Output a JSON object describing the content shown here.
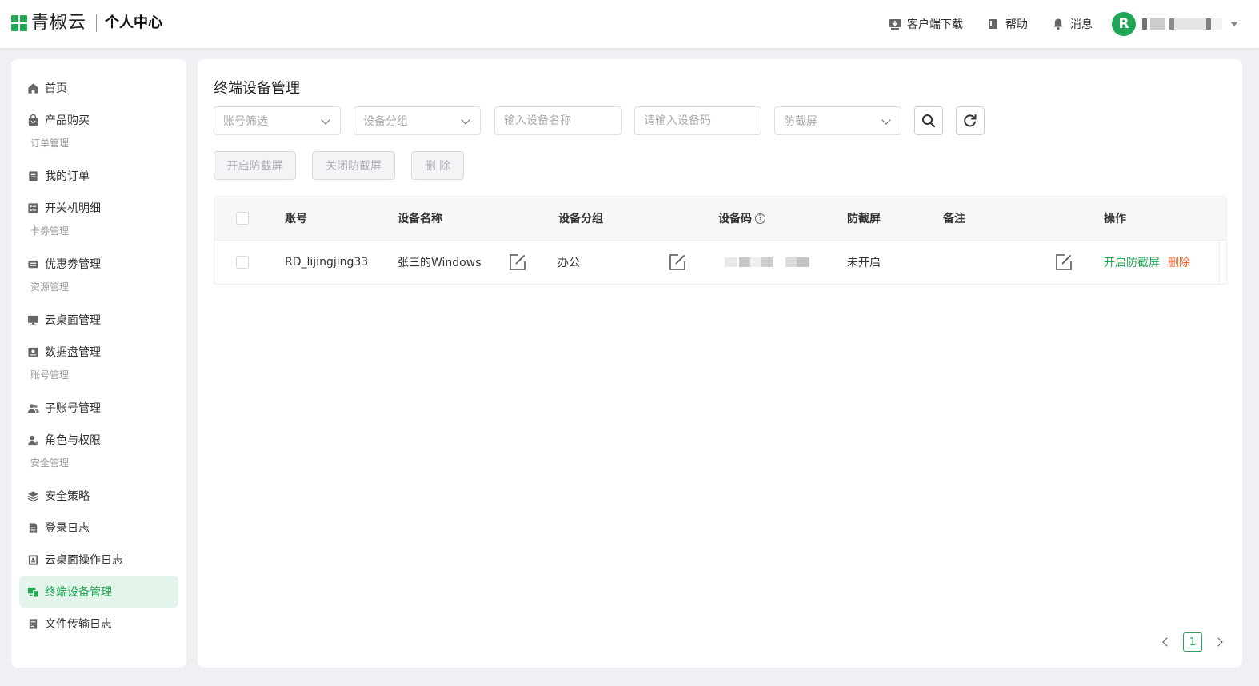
{
  "header": {
    "brand": "青椒云",
    "section": "个人中心",
    "links": [
      {
        "label": "客户端下载",
        "icon": "download-icon"
      },
      {
        "label": "帮助",
        "icon": "book-icon"
      },
      {
        "label": "消息",
        "icon": "bell-icon"
      }
    ],
    "avatar_letter": "R"
  },
  "sidebar": {
    "items": [
      {
        "type": "item",
        "label": "首页",
        "icon": "home-icon"
      },
      {
        "type": "item",
        "label": "产品购买",
        "icon": "shopping-bag-icon"
      },
      {
        "type": "group",
        "label": "订单管理"
      },
      {
        "type": "item",
        "label": "我的订单",
        "icon": "order-icon"
      },
      {
        "type": "item",
        "label": "开关机明细",
        "icon": "list-icon"
      },
      {
        "type": "group",
        "label": "卡劵管理"
      },
      {
        "type": "item",
        "label": "优惠劵管理",
        "icon": "ticket-icon"
      },
      {
        "type": "group",
        "label": "资源管理"
      },
      {
        "type": "item",
        "label": "云桌面管理",
        "icon": "monitor-icon"
      },
      {
        "type": "item",
        "label": "数据盘管理",
        "icon": "disk-icon"
      },
      {
        "type": "group",
        "label": "账号管理"
      },
      {
        "type": "item",
        "label": "子账号管理",
        "icon": "users-icon"
      },
      {
        "type": "item",
        "label": "角色与权限",
        "icon": "user-key-icon"
      },
      {
        "type": "group",
        "label": "安全管理"
      },
      {
        "type": "item",
        "label": "安全策略",
        "icon": "layers-icon"
      },
      {
        "type": "item",
        "label": "登录日志",
        "icon": "document-icon"
      },
      {
        "type": "item",
        "label": "云桌面操作日志",
        "icon": "log-icon"
      },
      {
        "type": "item",
        "label": "终端设备管理",
        "icon": "devices-icon",
        "active": true
      },
      {
        "type": "item",
        "label": "文件传输日志",
        "icon": "file-icon"
      }
    ]
  },
  "main": {
    "title": "终端设备管理",
    "filters": {
      "account_placeholder": "账号筛选",
      "group_placeholder": "设备分组",
      "device_name_placeholder": "输入设备名称",
      "device_code_placeholder": "请输入设备码",
      "screenshot_placeholder": "防截屏"
    },
    "actions": {
      "enable_label": "开启防截屏",
      "disable_label": "关闭防截屏",
      "delete_label": "删 除"
    },
    "table": {
      "headers": {
        "account": "账号",
        "device_name": "设备名称",
        "device_group": "设备分组",
        "device_code": "设备码",
        "anti_screenshot": "防截屏",
        "remark": "备注",
        "operation": "操作"
      },
      "rows": [
        {
          "account": "RD_lijingjing33",
          "device_name": "张三的Windows",
          "device_group": "办公",
          "anti_screenshot": "未开启",
          "remark": "",
          "op_enable": "开启防截屏",
          "op_delete": "删除"
        }
      ]
    },
    "pagination": {
      "current": "1"
    }
  },
  "colors": {
    "accent": "#21a655",
    "danger": "#f5642d",
    "active_bg": "#e3f5ea"
  }
}
